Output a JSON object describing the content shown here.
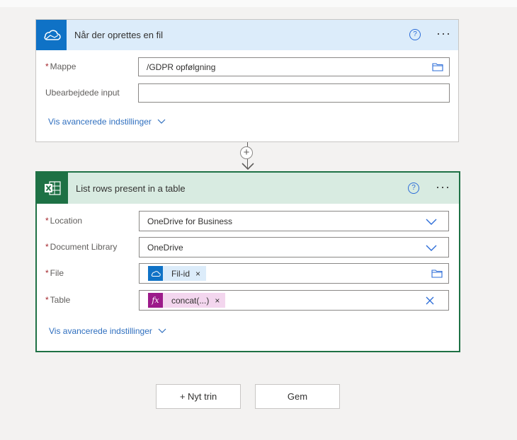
{
  "trigger": {
    "title": "Når der oprettes en fil",
    "icon": "onedrive-cloud-icon",
    "help_glyph": "?",
    "more_glyph": "···",
    "fields": {
      "mappe_label": "Mappe",
      "mappe_value": "/GDPR opfølgning",
      "ubearbejdede_label": "Ubearbejdede input",
      "ubearbejdede_value": ""
    },
    "advanced_label": "Vis avancerede indstillinger"
  },
  "connector": {
    "plus_glyph": "+"
  },
  "action": {
    "title": "List rows present in a table",
    "icon": "excel-icon",
    "help_glyph": "?",
    "more_glyph": "···",
    "fields": {
      "location_label": "Location",
      "location_value": "OneDrive for Business",
      "library_label": "Document Library",
      "library_value": "OneDrive",
      "file_label": "File",
      "file_token": "Fil-id",
      "table_label": "Table",
      "table_token": "concat(...)",
      "fx_glyph": "fx",
      "remove_glyph": "×"
    },
    "advanced_label": "Vis avancerede indstillinger"
  },
  "buttons": {
    "new_step": "+ Nyt trin",
    "save": "Gem"
  },
  "required_mark": "*",
  "colors": {
    "trigger_header": "#dcecfa",
    "trigger_icon_bg": "#0f72c6",
    "action_header": "#d8ebe1",
    "action_border": "#1e7145",
    "link_blue": "#2f6fbf",
    "fx_token_bg": "#f3d6ee",
    "fx_icon_bg": "#9c1a8a",
    "file_token_bg": "#dcecfa"
  }
}
